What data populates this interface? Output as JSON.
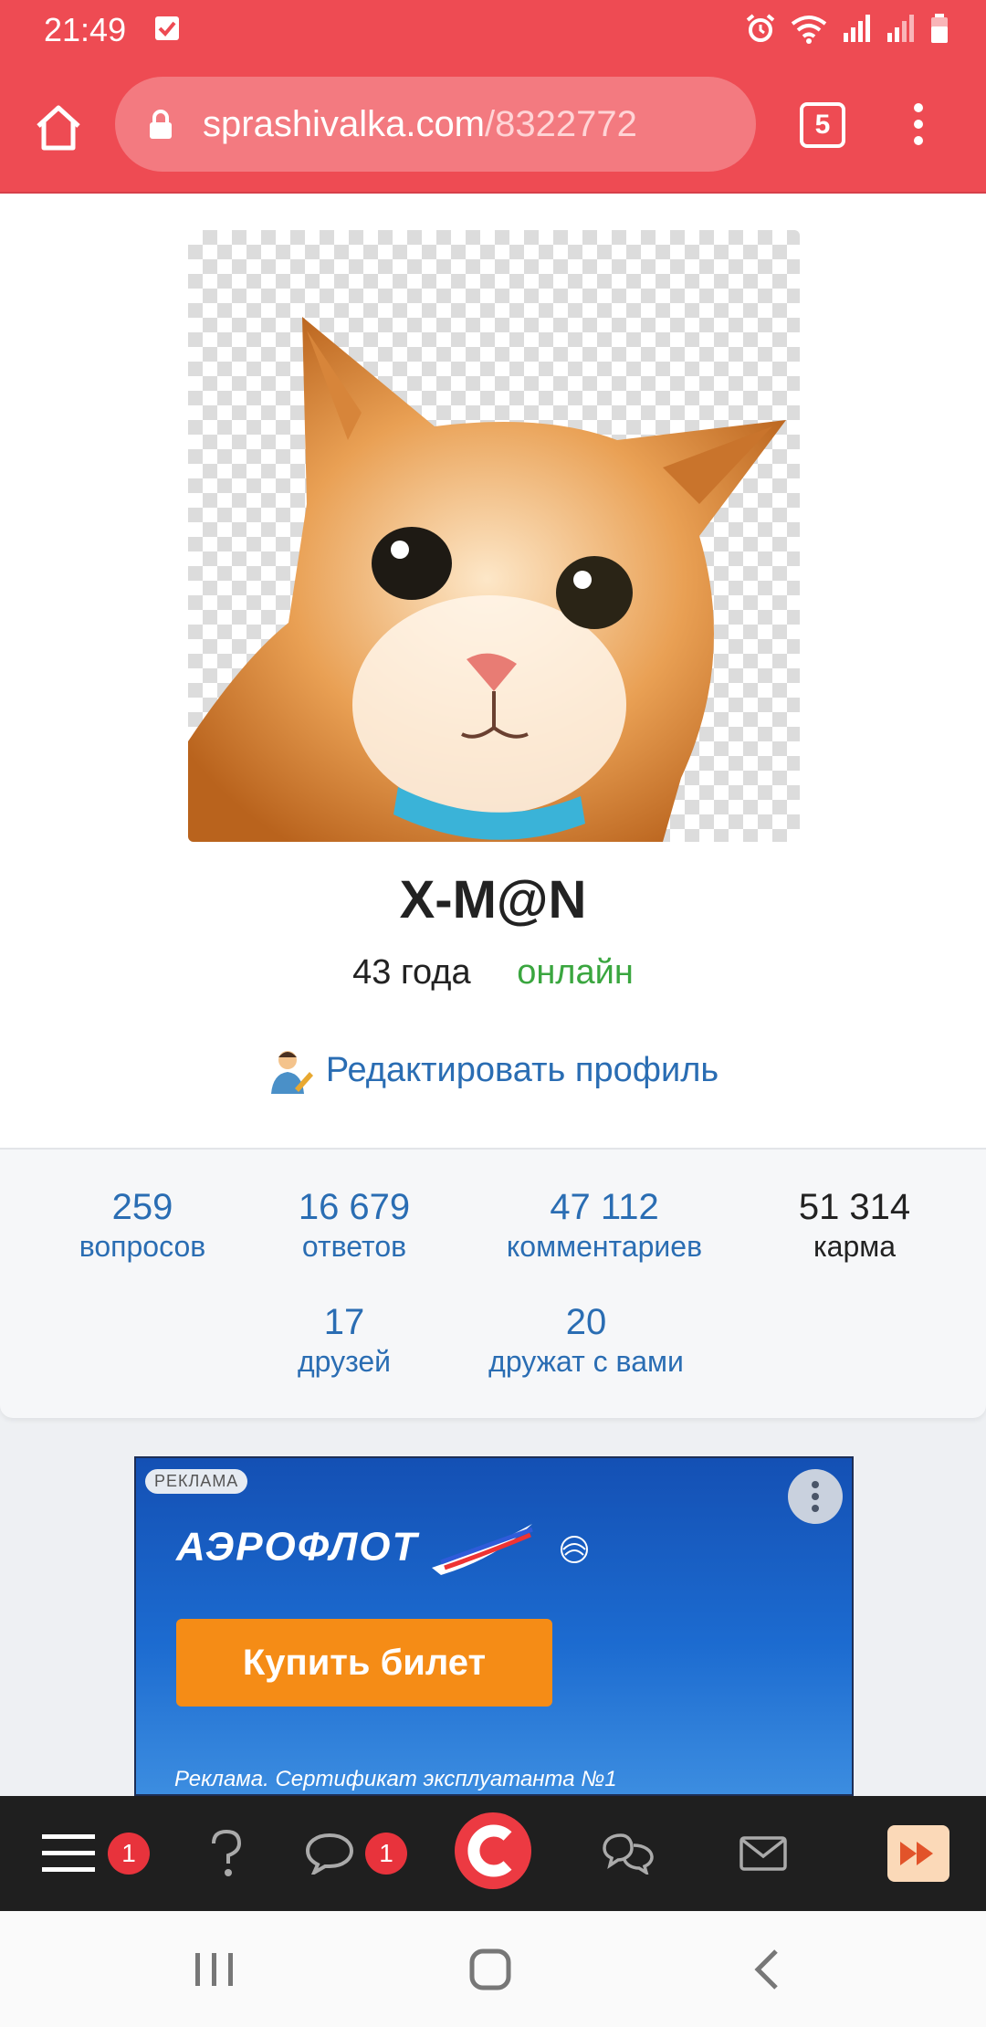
{
  "status_bar": {
    "time": "21:49"
  },
  "browser": {
    "url_host": "sprashivalka.com",
    "url_path": "/8322772",
    "tab_count": "5"
  },
  "profile": {
    "username": "X-M@N",
    "age": "43 года",
    "status": "онлайн",
    "edit_label": "Редактировать профиль"
  },
  "stats": [
    {
      "value": "259",
      "label": "вопросов"
    },
    {
      "value": "16 679",
      "label": "ответов"
    },
    {
      "value": "47 112",
      "label": "комментариев"
    },
    {
      "value": "51 314",
      "label": "карма"
    },
    {
      "value": "17",
      "label": "друзей"
    },
    {
      "value": "20",
      "label": "дружат с вами"
    }
  ],
  "ad": {
    "tag": "РЕКЛАМА",
    "brand": "АЭРОФЛОТ",
    "button": "Купить билет",
    "disclaimer": "Реклама. Сертификат эксплуатанта №1"
  },
  "toolbar": {
    "menu_badge": "1",
    "chat_badge": "1"
  },
  "colors": {
    "brand_red": "#ee4b53",
    "link_blue": "#2a6db3",
    "online_green": "#3aa63f",
    "ad_orange": "#f58c16"
  },
  "icons": [
    "home-icon",
    "lock-icon",
    "tabs-icon",
    "more-icon",
    "question-icon",
    "chat-icon",
    "logo-icon",
    "conversations-icon",
    "mail-icon",
    "fast-forward-icon",
    "recents-icon",
    "home-nav-icon",
    "back-icon"
  ]
}
